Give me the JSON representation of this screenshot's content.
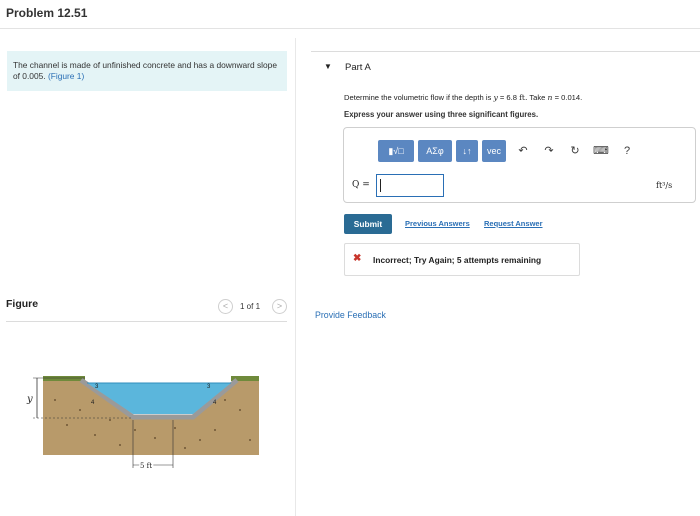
{
  "problem": {
    "title": "Problem 12.51",
    "text": "The channel is made of unfinished concrete and has a downward slope of 0.005.",
    "figure_link": "(Figure 1)"
  },
  "figure": {
    "label": "Figure",
    "pager": {
      "prev": "<",
      "next": ">",
      "text": "1 of 1"
    },
    "labels": {
      "depth": "y",
      "bottom_width": "5 ft",
      "side_slope_h": "4",
      "side_slope_v": "3"
    }
  },
  "part_a": {
    "caret": "▼",
    "label": "Part A",
    "question": {
      "pre": "Determine the volumetric flow if the depth is",
      "var_y": "y",
      "eq_y": "= 6.8",
      "unit_ft": "ft.",
      "mid": "Take",
      "var_n": "n",
      "eq_n": "= 0.014."
    },
    "instruction": "Express your answer using three significant figures.",
    "toolbar": {
      "template_label": "▮√□",
      "greek_label": "ΑΣφ",
      "arrows_label": "↓↑",
      "vec_label": "vec",
      "undo_icon": "↶",
      "redo_icon": "↷",
      "reset_icon": "↻",
      "keyboard_icon": "⌨",
      "help_label": "?"
    },
    "answer": {
      "variable": "Q =",
      "value": "",
      "units": "ft³/s"
    },
    "submit_label": "Submit",
    "previous_answers_label": "Previous Answers",
    "request_answer_label": "Request Answer",
    "feedback": {
      "icon": "✖",
      "text": "Incorrect; Try Again; 5 attempts remaining"
    }
  },
  "provide_feedback_label": "Provide Feedback",
  "colors": {
    "accent": "#2a6fb5",
    "submit": "#2a6b94",
    "toolbar": "#5b87c1",
    "problem_bg": "#e4f4f6",
    "error": "#c8352b",
    "water": "#5bb6dc",
    "soil": "#b89a6a"
  }
}
